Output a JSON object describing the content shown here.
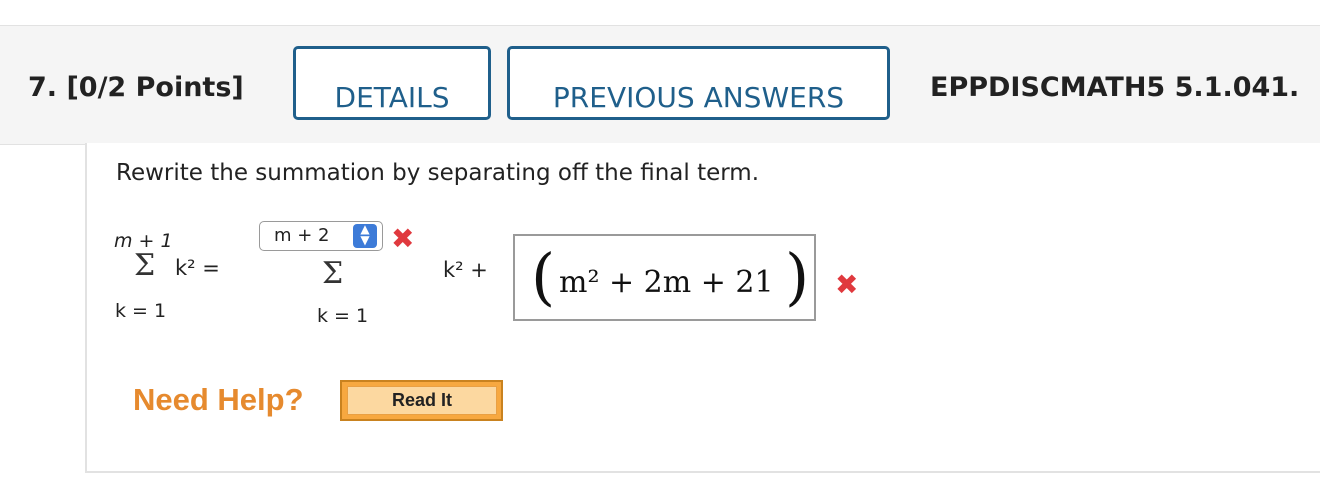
{
  "header": {
    "question_label": "7. [0/2 Points]",
    "details_label": "DETAILS",
    "previous_answers_label": "PREVIOUS ANSWERS",
    "reference": "EPPDISCMATH5 5.1.041."
  },
  "question": {
    "instruction": "Rewrite the summation by separating off the final term.",
    "left_sum": {
      "upper": "m + 1",
      "lower": "k = 1",
      "term": "k² ="
    },
    "right_sum": {
      "upper_selected": "m + 2",
      "lower": "k = 1",
      "term": "k² +"
    },
    "answer_expression": "m² + 2m + 21",
    "incorrect_marks": [
      "✖",
      "✖"
    ]
  },
  "help": {
    "label": "Need Help?",
    "read_it_label": "Read It"
  },
  "icons": {
    "select_arrow": "up-down-chevron-icon",
    "incorrect": "x-mark-icon"
  },
  "colors": {
    "accent": "#1f5f8b",
    "incorrect": "#e0393e",
    "help": "#e68a2e"
  }
}
